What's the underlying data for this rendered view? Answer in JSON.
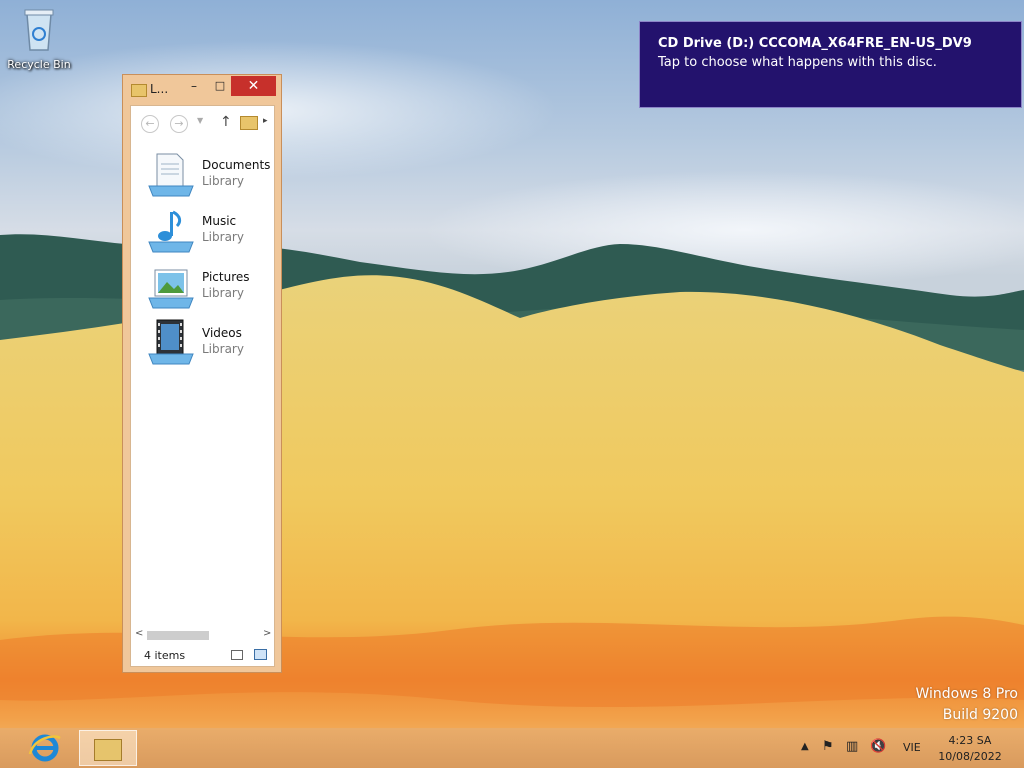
{
  "desktop": {
    "icons": [
      {
        "label": "Recycle Bin",
        "icon": "recycle-bin-icon"
      }
    ],
    "watermark": {
      "line1": "Windows 8 Pro",
      "line2": "Build 9200"
    }
  },
  "toast": {
    "title": "CD Drive (D:) CCCOMA_X64FRE_EN-US_DV9",
    "message": "Tap to choose what happens with this disc.",
    "background": "#23126d"
  },
  "explorer_window": {
    "title": "L...",
    "controls": {
      "minimize": "–",
      "maximize": "□",
      "close": "✕"
    },
    "nav": {
      "back": "←",
      "forward": "→",
      "up": "↑",
      "more": "▸"
    },
    "libraries": [
      {
        "name": "Documents",
        "type": "Library",
        "icon": "documents-library-icon"
      },
      {
        "name": "Music",
        "type": "Library",
        "icon": "music-library-icon"
      },
      {
        "name": "Pictures",
        "type": "Library",
        "icon": "pictures-library-icon"
      },
      {
        "name": "Videos",
        "type": "Library",
        "icon": "videos-library-icon"
      }
    ],
    "status": "4 items",
    "accent": "#f0c79a"
  },
  "taskbar": {
    "pinned": [
      {
        "name": "Internet Explorer",
        "icon": "internet-explorer-icon"
      },
      {
        "name": "File Explorer",
        "icon": "file-explorer-icon",
        "active": true
      }
    ],
    "tray": {
      "show_hidden": "▲",
      "language": "VIE",
      "time": "4:23 SA",
      "date": "10/08/2022"
    },
    "color": "#e0a56a"
  }
}
